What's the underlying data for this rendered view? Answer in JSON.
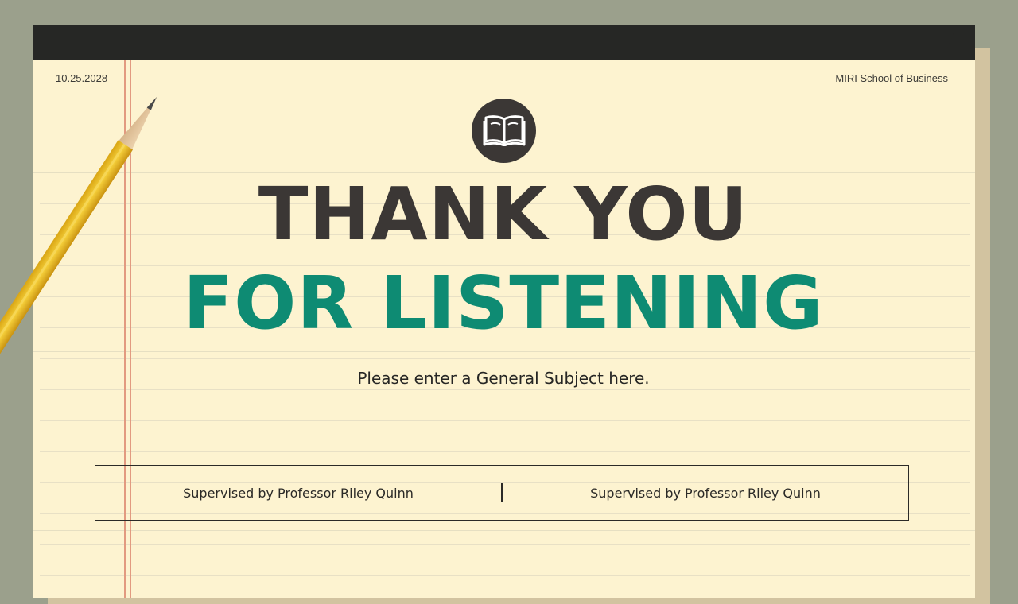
{
  "header": {
    "date": "10.25.2028",
    "school": "MIRI School of Business"
  },
  "title": {
    "line1": "THANK YOU",
    "line2": "FOR LISTENING"
  },
  "subject": "Please enter a General Subject here.",
  "supervisors": {
    "left": "Supervised by Professor Riley Quinn",
    "right": "Supervised by Professor Riley Quinn"
  },
  "icons": {
    "badge": "open-book-icon",
    "decoration": "pencil-icon"
  },
  "colors": {
    "paper": "#fdf3d0",
    "dark": "#3b3735",
    "accent": "#0e8b73",
    "background": "#9ba08c"
  }
}
